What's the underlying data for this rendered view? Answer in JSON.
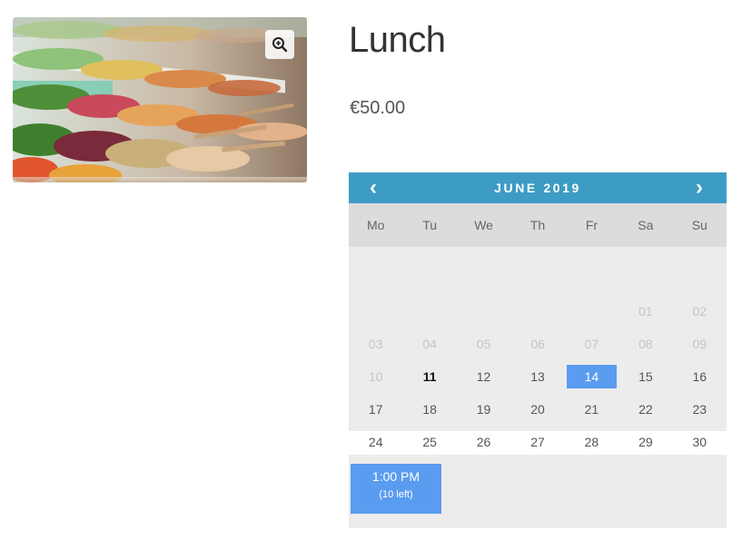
{
  "product": {
    "title": "Lunch",
    "price": "€50.00",
    "image_icon": "zoom-in-icon"
  },
  "calendar": {
    "month_label": "JUNE 2019",
    "prev_label": "‹",
    "next_label": "›",
    "weekdays": [
      "Mo",
      "Tu",
      "We",
      "Th",
      "Fr",
      "Sa",
      "Su"
    ],
    "weeks": [
      [
        "",
        "",
        "",
        "",
        "",
        "01",
        "02"
      ],
      [
        "03",
        "04",
        "05",
        "06",
        "07",
        "08",
        "09"
      ],
      [
        "10",
        "11",
        "12",
        "13",
        "14",
        "15",
        "16"
      ],
      [
        "17",
        "18",
        "19",
        "20",
        "21",
        "22",
        "23"
      ],
      [
        "24",
        "25",
        "26",
        "27",
        "28",
        "29",
        "30"
      ]
    ],
    "disabled_days": [
      "01",
      "02",
      "03",
      "04",
      "05",
      "06",
      "07",
      "08",
      "09",
      "10"
    ],
    "today": "11",
    "selected": "14",
    "colors": {
      "header": "#3d9cc3",
      "selected": "#5a9cf0",
      "background": "#ececec"
    }
  },
  "timeslots": [
    {
      "time": "1:00 PM",
      "availability": "(10 left)"
    }
  ]
}
